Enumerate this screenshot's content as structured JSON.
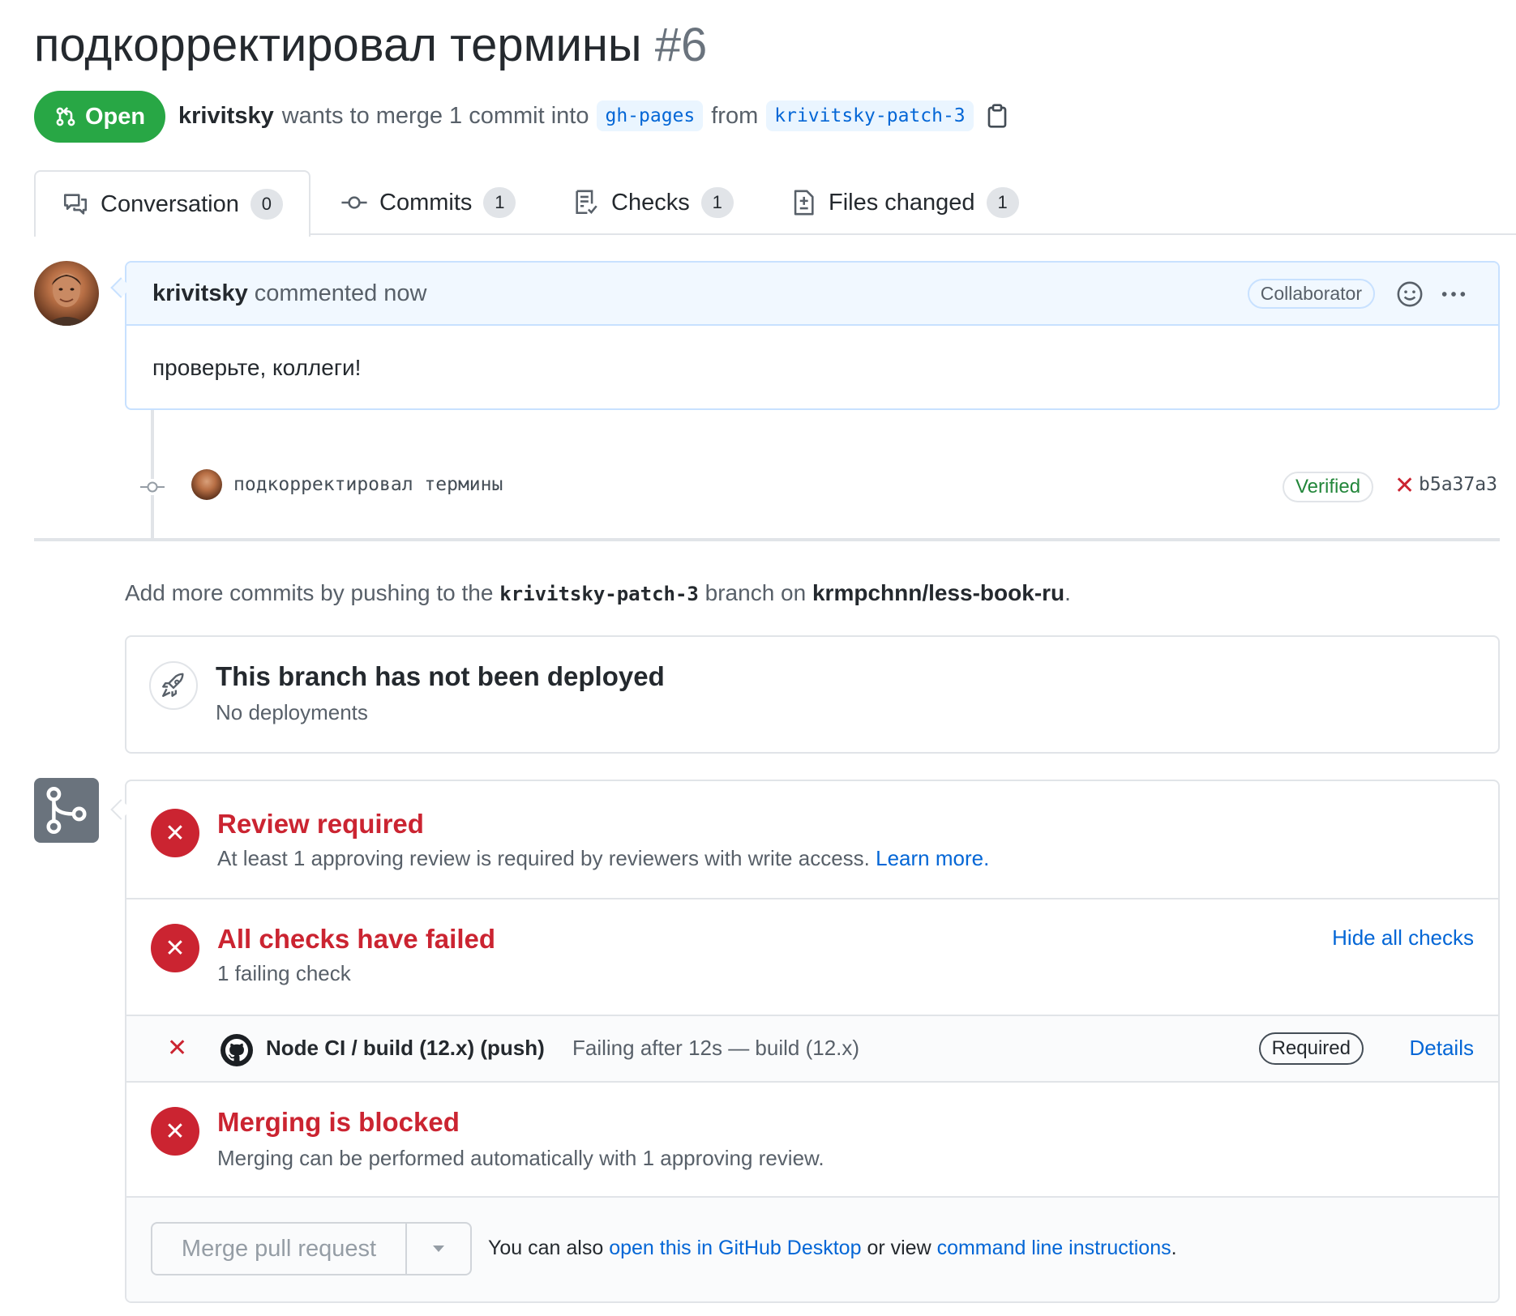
{
  "header": {
    "title": "подкорректировал термины",
    "number": "#6",
    "state": "Open",
    "author": "krivitsky",
    "merge_text": "wants to merge 1 commit into",
    "base_branch": "gh-pages",
    "from_text": "from",
    "head_branch": "krivitsky-patch-3"
  },
  "tabs": [
    {
      "label": "Conversation",
      "count": "0"
    },
    {
      "label": "Commits",
      "count": "1"
    },
    {
      "label": "Checks",
      "count": "1"
    },
    {
      "label": "Files changed",
      "count": "1"
    }
  ],
  "comment": {
    "author": "krivitsky",
    "action": "commented now",
    "badge": "Collaborator",
    "body": "проверьте, коллеги!"
  },
  "commit": {
    "message": "подкорректировал термины",
    "verified": "Verified",
    "status_icon": "✕",
    "sha": "b5a37a3"
  },
  "push_note": {
    "prefix": "Add more commits by pushing to the",
    "branch": "krivitsky-patch-3",
    "middle": "branch on",
    "repo": "krmpchnn/less-book-ru",
    "suffix": "."
  },
  "deployment": {
    "title": "This branch has not been deployed",
    "subtitle": "No deployments"
  },
  "merge_status": {
    "review": {
      "title": "Review required",
      "text": "At least 1 approving review is required by reviewers with write access.",
      "link": "Learn more."
    },
    "checks": {
      "title": "All checks have failed",
      "text": "1 failing check",
      "toggle": "Hide all checks"
    },
    "check_row": {
      "name": "Node CI / build (12.x) (push)",
      "description": "Failing after 12s — build (12.x)",
      "badge": "Required",
      "details": "Details"
    },
    "blocked": {
      "title": "Merging is blocked",
      "text": "Merging can be performed automatically with 1 approving review."
    },
    "footer": {
      "button": "Merge pull request",
      "text_1": "You can also",
      "link_1": "open this in GitHub Desktop",
      "text_2": "or view",
      "link_2": "command line instructions",
      "text_3": "."
    }
  },
  "colors": {
    "open_green": "#28a745",
    "fail_red": "#cb2431",
    "link_blue": "#0366d6"
  }
}
